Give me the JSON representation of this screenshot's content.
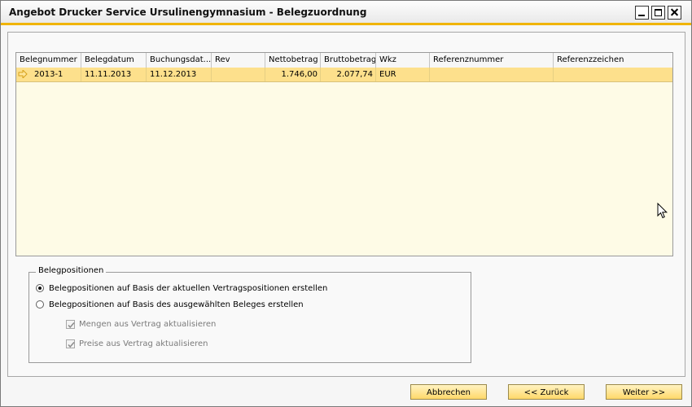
{
  "window": {
    "title": "Angebot Drucker Service Ursulinengymnasium - Belegzuordnung"
  },
  "grid": {
    "columns": [
      "Belegnummer",
      "Belegdatum",
      "Buchungsdat...",
      "Rev",
      "Nettobetrag",
      "Bruttobetrag",
      "Wkz",
      "Referenznummer",
      "Referenzzeichen"
    ],
    "rows": [
      {
        "belegnummer": "2013-1",
        "belegdatum": "11.11.2013",
        "buchungsdatum": "11.12.2013",
        "rev": "",
        "nettobetrag": "1.746,00",
        "bruttobetrag": "2.077,74",
        "wkz": "EUR",
        "referenznummer": "",
        "referenzzeichen": ""
      }
    ]
  },
  "belegpositionen": {
    "legend": "Belegpositionen",
    "option_vertrag": "Belegpositionen auf Basis der aktuellen Vertragspositionen erstellen",
    "option_beleg": "Belegpositionen auf Basis des ausgewählten Beleges erstellen",
    "check_mengen": "Mengen aus Vertrag aktualisieren",
    "check_preise": "Preise aus Vertrag aktualisieren"
  },
  "buttons": {
    "abbrechen": "Abbrechen",
    "zurueck": "<< Zurück",
    "weiter": "Weiter >>"
  },
  "colors": {
    "accent": "#f0b400",
    "selected_row": "#fde08c",
    "grid_bg": "#fefbe6",
    "button": "#ffd86a"
  }
}
